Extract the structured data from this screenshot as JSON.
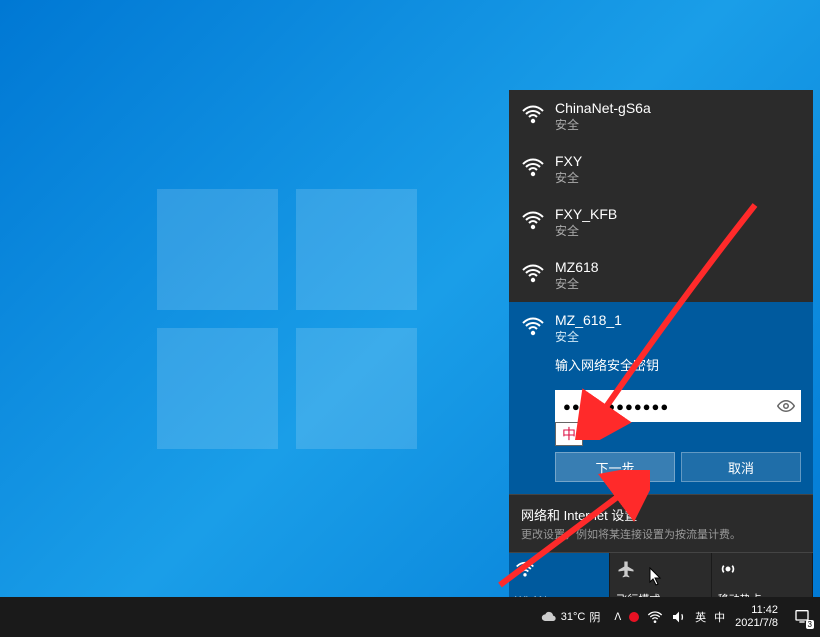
{
  "wifi_list": [
    {
      "name": "ChinaNet-gS6a",
      "status": "安全"
    },
    {
      "name": "FXY",
      "status": "安全"
    },
    {
      "name": "FXY_KFB",
      "status": "安全"
    },
    {
      "name": "MZ618",
      "status": "安全"
    }
  ],
  "selected_wifi": {
    "name": "MZ_618_1",
    "status": "安全",
    "prompt": "输入网络安全密钥",
    "password_masked": "●●●●●●●●●●●●",
    "ime_label": "中",
    "next_btn": "下一步",
    "cancel_btn": "取消"
  },
  "settings": {
    "title": "网络和 Internet 设置",
    "subtitle": "更改设置，例如将某连接设置为按流量计费。"
  },
  "tiles": {
    "wlan": "WLAN",
    "airplane": "飞行模式",
    "hotspot": "移动热点"
  },
  "taskbar": {
    "weather_temp": "31°C",
    "weather_cond": "阴",
    "chevron": "ᐱ",
    "ime1": "英",
    "ime2": "中",
    "time": "11:42",
    "date": "2021/7/8",
    "notif_count": "3"
  }
}
